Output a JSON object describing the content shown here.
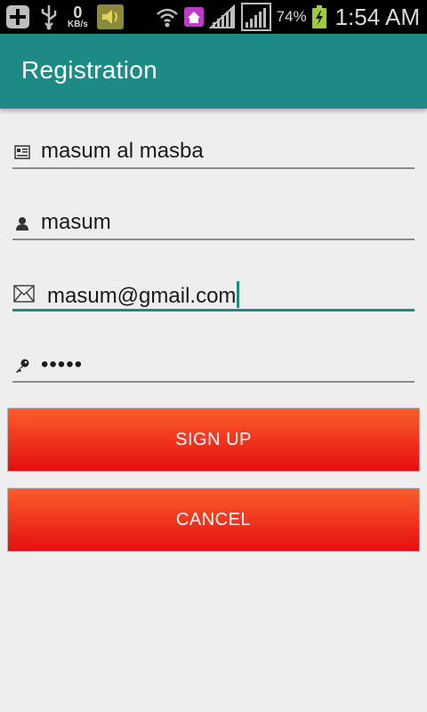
{
  "status_bar": {
    "net_speed": "0",
    "net_unit": "KB/s",
    "battery_percent": "74%",
    "time": "1:54 AM"
  },
  "toolbar": {
    "title": "Registration"
  },
  "form": {
    "full_name": "masum al masba",
    "username": "masum",
    "email": "masum@gmail.com",
    "password": "•••••"
  },
  "buttons": {
    "sign_up": "SIGN UP",
    "cancel": "CANCEL"
  },
  "colors": {
    "primary": "#1d8a86",
    "button_top": "#fb5e2b",
    "button_bottom": "#e50f10",
    "background": "#eeeeee"
  }
}
